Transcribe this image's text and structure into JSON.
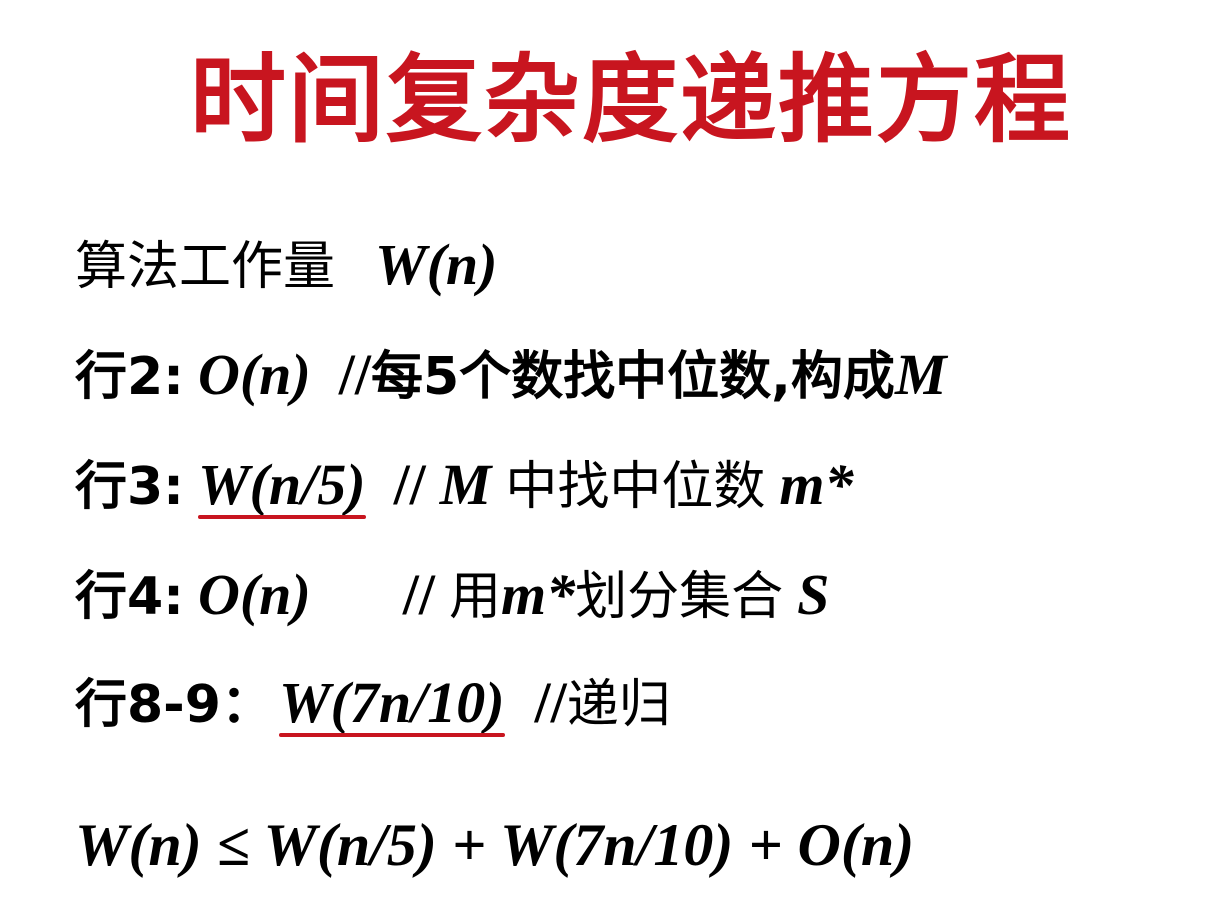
{
  "title": "时间复杂度递推方程",
  "lines": [
    {
      "label": "算法工作量",
      "expr": "W(n)"
    },
    {
      "label": "行2:",
      "expr": "O(n)",
      "comment_prefix": "//",
      "comment": "每5个数找中位数,构成",
      "comment_var": "M"
    },
    {
      "label": "行3:",
      "expr": "W(n/5)",
      "comment_prefix": "//",
      "comment_var_pre": "M",
      "comment": "中找中位数",
      "comment_var": "m*"
    },
    {
      "label": "行4:",
      "expr": "O(n)",
      "comment_prefix": "//",
      "comment_pre": "用",
      "comment_var_mid": "m*",
      "comment": "划分集合",
      "comment_var": "S"
    },
    {
      "label": "行8-9：",
      "expr": "W(7n/10)",
      "comment_prefix": "//",
      "comment": "递归"
    }
  ],
  "equation": "W(n) ≤ W(n/5) + W(7n/10) + O(n)",
  "colors": {
    "title": "#c8151f",
    "underline": "#c8151f",
    "text": "#000000"
  }
}
